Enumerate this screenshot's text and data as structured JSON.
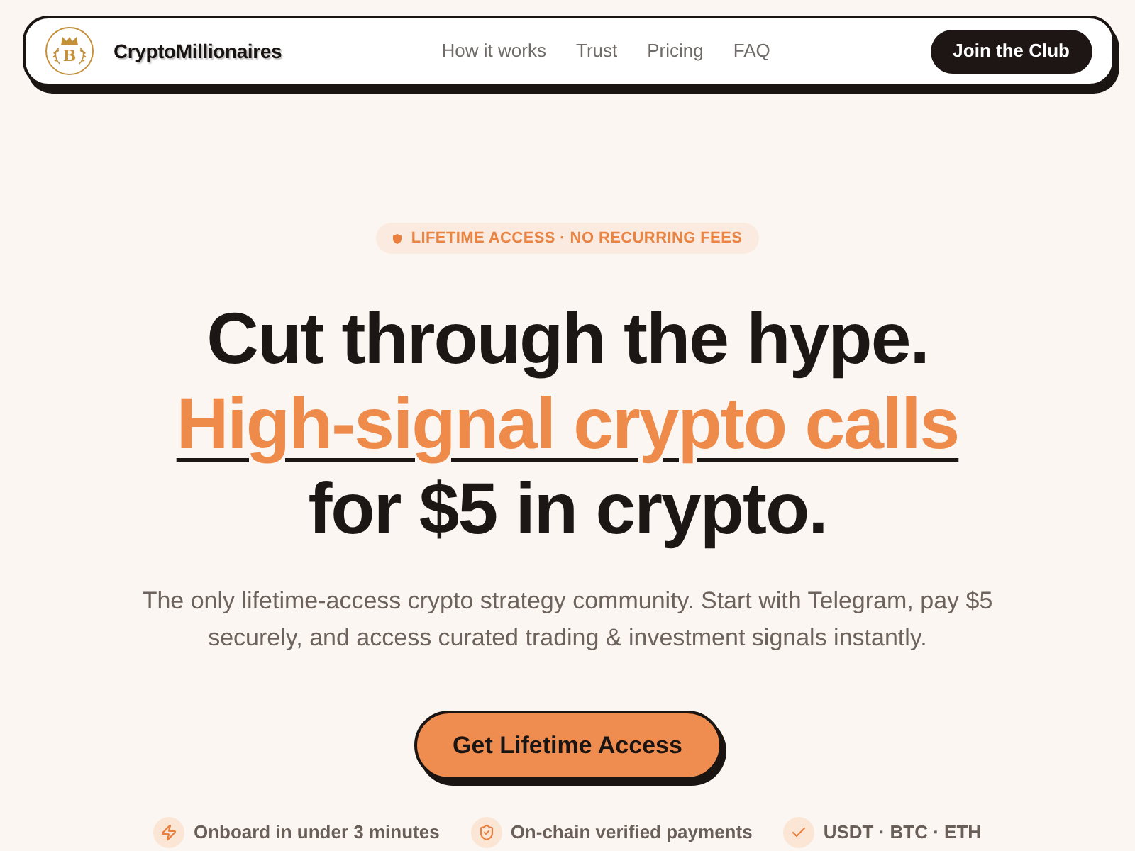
{
  "nav": {
    "brand": {
      "logo_letter": "B",
      "name": "CryptoMillionaires"
    },
    "links": [
      "How it works",
      "Trust",
      "Pricing",
      "FAQ"
    ],
    "cta": "Join the Club"
  },
  "hero": {
    "badge": "LIFETIME ACCESS · NO RECURRING FEES",
    "headline": [
      {
        "text": "Cut through the hype.",
        "highlighted": false
      },
      {
        "text": "High-signal crypto calls",
        "highlighted": true
      },
      {
        "text": "for $5 in crypto.",
        "highlighted": false
      }
    ],
    "subtitle": "The only lifetime-access crypto strategy community. Start with Telegram, pay $5 securely, and access curated trading & investment signals instantly.",
    "cta": "Get Lifetime Access",
    "features": [
      {
        "kind": "speed",
        "label": "Onboard in under 3 minutes"
      },
      {
        "kind": "secure",
        "label": "On-chain verified payments"
      },
      {
        "kind": "check",
        "label": "USDT · BTC · ETH"
      }
    ]
  }
}
